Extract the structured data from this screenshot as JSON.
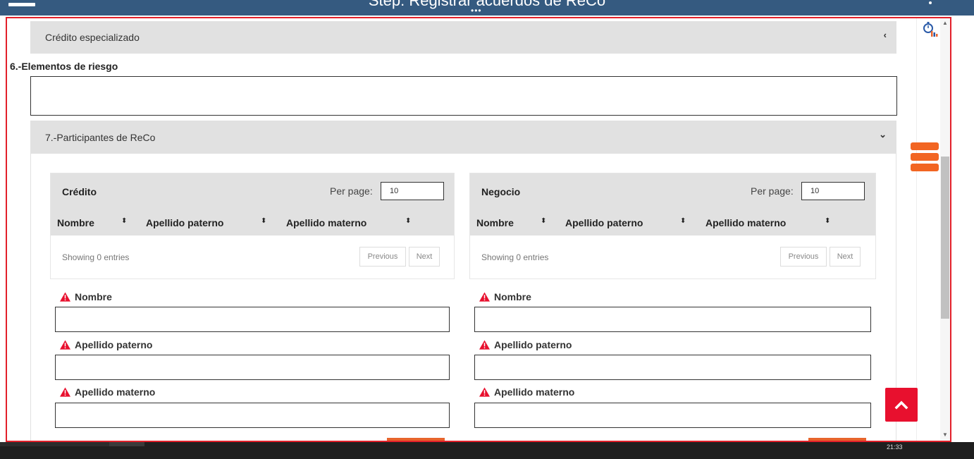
{
  "window": {
    "title": "Step: Registrar acuerdos de ReCo",
    "more_dots": "•••"
  },
  "panels": {
    "credito_especializado": {
      "label": "Crédito especializado",
      "chevron": "‹"
    },
    "participantes": {
      "label": "7.-Participantes de ReCo",
      "chevron": "⌄"
    }
  },
  "riesgo": {
    "title": "6.-Elementos de riesgo",
    "value": ""
  },
  "tables": [
    {
      "name": "Crédito",
      "per_page_label": "Per page:",
      "per_page_value": "10",
      "columns": [
        "Nombre",
        "Apellido paterno",
        "Apellido materno"
      ],
      "showing": "Showing 0 entries",
      "prev": "Previous",
      "next": "Next"
    },
    {
      "name": "Negocio",
      "per_page_label": "Per page:",
      "per_page_value": "10",
      "columns": [
        "Nombre",
        "Apellido paterno",
        "Apellido materno"
      ],
      "showing": "Showing 0 entries",
      "prev": "Previous",
      "next": "Next"
    }
  ],
  "form_left": {
    "nombre": "Nombre",
    "apellido_paterno": "Apellido paterno",
    "apellido_materno": "Apellido materno"
  },
  "form_right": {
    "nombre": "Nombre",
    "apellido_paterno": "Apellido paterno",
    "apellido_materno": "Apellido materno"
  },
  "sort_glyph": "⬍",
  "taskbar": {
    "clock": "21:33"
  },
  "colors": {
    "header_bg": "#355a80",
    "frame_border": "#e2202a",
    "accent_orange": "#f26522",
    "back_to_top": "#e8102e",
    "warning": "#e8102e"
  },
  "icons": [
    "menu-icon",
    "kebab-icon",
    "timer-chart-icon",
    "hamburger-menu-icon",
    "chevron-up-icon",
    "warning-icon",
    "sort-icon"
  ]
}
